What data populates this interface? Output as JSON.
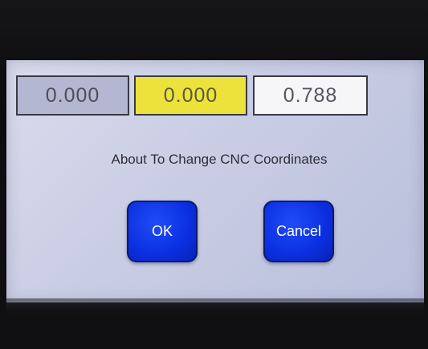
{
  "dialog": {
    "coordinates": {
      "x": "0.000",
      "y": "0.000",
      "z": "0.788"
    },
    "message": "About To Change CNC Coordinates",
    "ok_label": "OK",
    "cancel_label": "Cancel"
  },
  "colors": {
    "screen_background": "#c9cde4",
    "x_field": "#b3b7d2",
    "y_field_highlight": "#ede23c",
    "z_field": "#f6f6f8",
    "button": "#0b2fe0"
  }
}
